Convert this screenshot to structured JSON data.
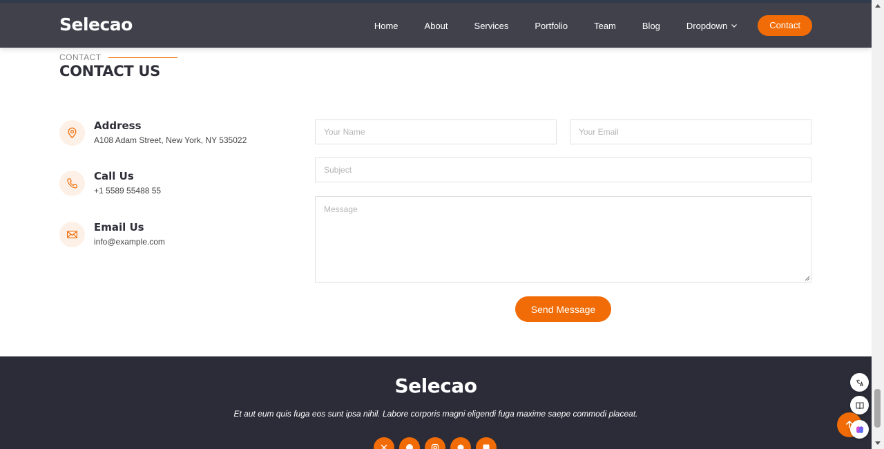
{
  "header": {
    "logo": "Selecao",
    "nav": [
      "Home",
      "About",
      "Services",
      "Portfolio",
      "Team",
      "Blog",
      "Dropdown"
    ],
    "contact_label": "Contact"
  },
  "section": {
    "subtitle": "CONTACT",
    "title": "CONTACT US"
  },
  "info": [
    {
      "title": "Address",
      "text": "A108 Adam Street, New York, NY 535022",
      "icon": "map-pin-icon"
    },
    {
      "title": "Call Us",
      "text": "+1 5589 55488 55",
      "icon": "phone-icon"
    },
    {
      "title": "Email Us",
      "text": "info@example.com",
      "icon": "envelope-icon"
    }
  ],
  "form": {
    "name_placeholder": "Your Name",
    "email_placeholder": "Your Email",
    "subject_placeholder": "Subject",
    "message_placeholder": "Message",
    "send_label": "Send Message"
  },
  "footer": {
    "logo": "Selecao",
    "text": "Et aut eum quis fuga eos sunt ipsa nihil. Labore corporis magni eligendi fuga maxime saepe commodi placeat.",
    "socials": [
      "x-twitter-icon",
      "facebook-icon",
      "instagram-icon",
      "skype-icon",
      "linkedin-icon"
    ]
  },
  "colors": {
    "accent": "#f16c06",
    "header_bg": "#40414b",
    "footer_bg": "#2b2c38"
  }
}
